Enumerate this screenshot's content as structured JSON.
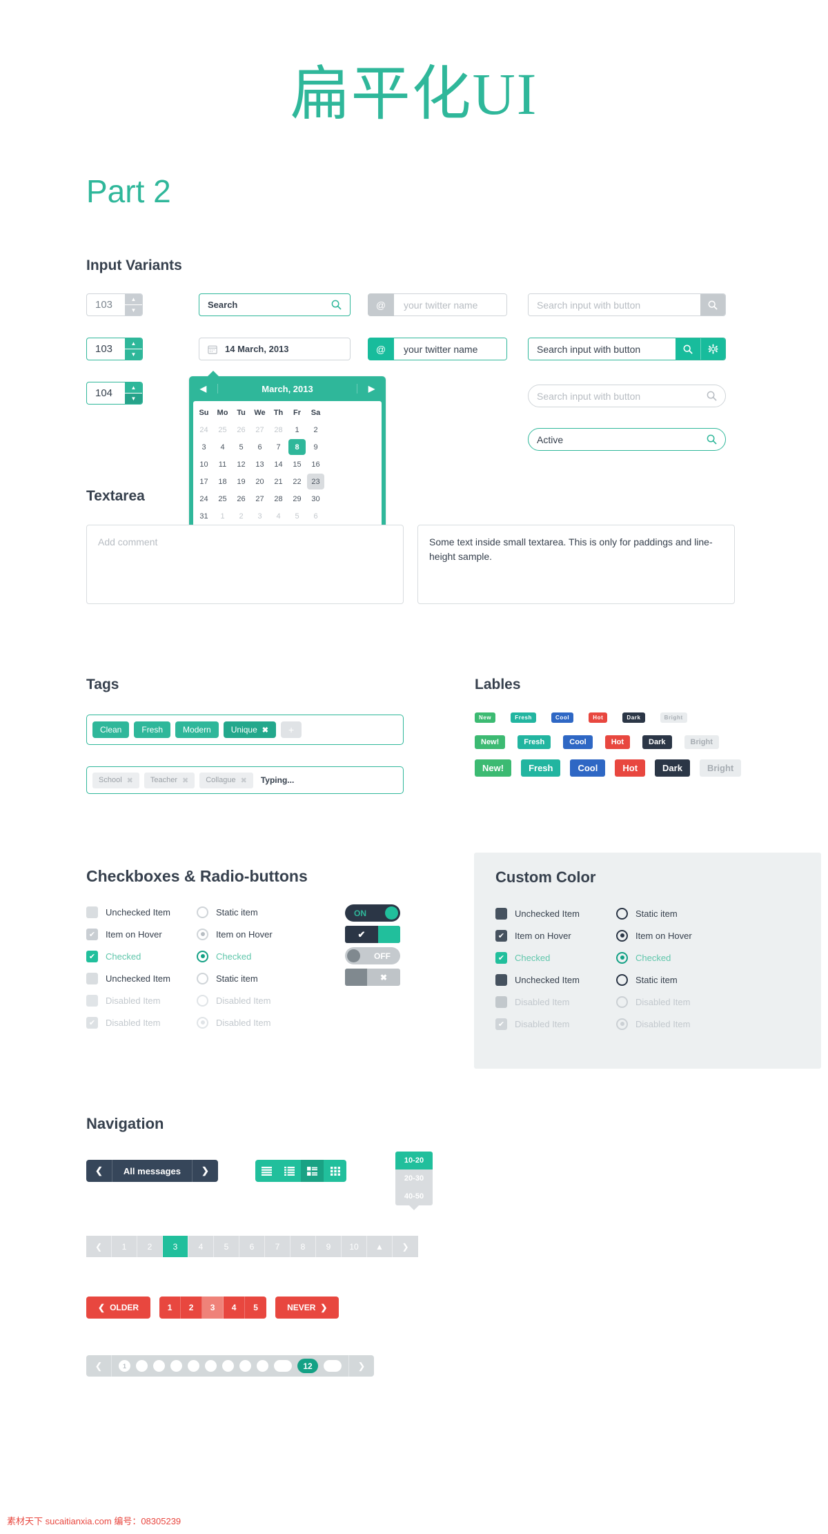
{
  "header": {
    "title": "扁平化UI",
    "subtitle": "Part 2"
  },
  "sections": {
    "input_variants": "Input Variants",
    "textarea": "Textarea",
    "tags": "Tags",
    "labels": "Lables",
    "checkboxes": "Checkboxes & Radio-buttons",
    "custom_color": "Custom Color",
    "navigation": "Navigation"
  },
  "inputs": {
    "spinners": [
      {
        "value": "103",
        "style": "plain"
      },
      {
        "value": "103",
        "style": "teal"
      },
      {
        "value": "104",
        "style": "teal-dark"
      }
    ],
    "search_label": "Search",
    "date_value": "14 March, 2013",
    "twitter_placeholder": "your twitter name",
    "twitter_value": "your twitter name",
    "twitter_prefix": "@",
    "search_button_placeholder": "Search input with button",
    "search_button_value": "Search input with button",
    "rounded_placeholder": "Search input with button",
    "active_value": "Active"
  },
  "datepicker": {
    "title": "March, 2013",
    "prev": "◀",
    "next": "▶",
    "dow": [
      "Su",
      "Mo",
      "Tu",
      "We",
      "Th",
      "Fr",
      "Sa"
    ],
    "weeks": [
      [
        {
          "d": "24",
          "s": "mute"
        },
        {
          "d": "25",
          "s": "mute"
        },
        {
          "d": "26",
          "s": "mute"
        },
        {
          "d": "27",
          "s": "mute"
        },
        {
          "d": "28",
          "s": "mute"
        },
        {
          "d": "1",
          "s": ""
        },
        {
          "d": "2",
          "s": ""
        }
      ],
      [
        {
          "d": "3",
          "s": ""
        },
        {
          "d": "4",
          "s": ""
        },
        {
          "d": "5",
          "s": ""
        },
        {
          "d": "6",
          "s": ""
        },
        {
          "d": "7",
          "s": ""
        },
        {
          "d": "8",
          "s": "sel"
        },
        {
          "d": "9",
          "s": ""
        }
      ],
      [
        {
          "d": "10",
          "s": ""
        },
        {
          "d": "11",
          "s": ""
        },
        {
          "d": "12",
          "s": ""
        },
        {
          "d": "13",
          "s": ""
        },
        {
          "d": "14",
          "s": ""
        },
        {
          "d": "15",
          "s": ""
        },
        {
          "d": "16",
          "s": ""
        }
      ],
      [
        {
          "d": "17",
          "s": ""
        },
        {
          "d": "18",
          "s": ""
        },
        {
          "d": "19",
          "s": ""
        },
        {
          "d": "20",
          "s": ""
        },
        {
          "d": "21",
          "s": ""
        },
        {
          "d": "22",
          "s": ""
        },
        {
          "d": "23",
          "s": "hl"
        }
      ],
      [
        {
          "d": "24",
          "s": ""
        },
        {
          "d": "25",
          "s": ""
        },
        {
          "d": "26",
          "s": ""
        },
        {
          "d": "27",
          "s": ""
        },
        {
          "d": "28",
          "s": ""
        },
        {
          "d": "29",
          "s": ""
        },
        {
          "d": "30",
          "s": ""
        }
      ],
      [
        {
          "d": "31",
          "s": ""
        },
        {
          "d": "1",
          "s": "mute"
        },
        {
          "d": "2",
          "s": "mute"
        },
        {
          "d": "3",
          "s": "mute"
        },
        {
          "d": "4",
          "s": "mute"
        },
        {
          "d": "5",
          "s": "mute"
        },
        {
          "d": "6",
          "s": "mute"
        }
      ]
    ]
  },
  "textarea": {
    "placeholder": "Add comment",
    "small_text": "Some text inside small textarea. This is only for paddings and line-height sample."
  },
  "tags": {
    "row1": [
      {
        "label": "Clean",
        "closable": false
      },
      {
        "label": "Fresh",
        "closable": false
      },
      {
        "label": "Modern",
        "closable": false
      },
      {
        "label": "Unique",
        "closable": true
      }
    ],
    "add_label": "+",
    "row2": [
      {
        "label": "School"
      },
      {
        "label": "Teacher"
      },
      {
        "label": "Collague"
      }
    ],
    "typing": "Typing...",
    "close_glyph": "✖"
  },
  "labels": {
    "small": [
      {
        "text": "New",
        "color": "#3cba72"
      },
      {
        "text": "Fresh",
        "color": "#22b5a0"
      },
      {
        "text": "Cool",
        "color": "#2e67c4"
      },
      {
        "text": "Hot",
        "color": "#e8473f"
      },
      {
        "text": "Dark",
        "color": "#2b3646"
      },
      {
        "text": "Bright",
        "color": "#e9ecee",
        "fg": "#a7adb3"
      }
    ],
    "medium": [
      {
        "text": "New!",
        "color": "#3cba72"
      },
      {
        "text": "Fresh",
        "color": "#22b5a0"
      },
      {
        "text": "Cool",
        "color": "#2e67c4"
      },
      {
        "text": "Hot",
        "color": "#e8473f"
      },
      {
        "text": "Dark",
        "color": "#2b3646"
      },
      {
        "text": "Bright",
        "color": "#e9ecee",
        "fg": "#a7adb3"
      }
    ],
    "large": [
      {
        "text": "New!",
        "color": "#3cba72"
      },
      {
        "text": "Fresh",
        "color": "#22b5a0"
      },
      {
        "text": "Cool",
        "color": "#2e67c4"
      },
      {
        "text": "Hot",
        "color": "#e8473f"
      },
      {
        "text": "Dark",
        "color": "#2b3646"
      },
      {
        "text": "Bright",
        "color": "#e9ecee",
        "fg": "#a7adb3"
      }
    ]
  },
  "checkboxes": {
    "left": [
      {
        "label": "Unchecked Item",
        "state": "unchecked"
      },
      {
        "label": "Item on Hover",
        "state": "hover"
      },
      {
        "label": "Checked",
        "state": "checked"
      },
      {
        "label": "Unchecked Item",
        "state": "unchecked"
      },
      {
        "label": "Disabled Item",
        "state": "disabled"
      },
      {
        "label": "Disabled Item",
        "state": "disabled-checked"
      }
    ],
    "right": [
      {
        "label": "Static item",
        "state": "static"
      },
      {
        "label": "Item on Hover",
        "state": "hover"
      },
      {
        "label": "Checked",
        "state": "checked"
      },
      {
        "label": "Static item",
        "state": "static"
      },
      {
        "label": "Disabled Item",
        "state": "disabled"
      },
      {
        "label": "Disabled Item",
        "state": "disabled-checked"
      }
    ]
  },
  "custom": {
    "left": [
      {
        "label": "Unchecked Item",
        "state": "unchecked"
      },
      {
        "label": "Item on Hover",
        "state": "hover"
      },
      {
        "label": "Checked",
        "state": "checked"
      },
      {
        "label": "Unchecked Item",
        "state": "unchecked"
      },
      {
        "label": "Disabled Item",
        "state": "disabled"
      },
      {
        "label": "Disabled Item",
        "state": "disabled-checked"
      }
    ],
    "right": [
      {
        "label": "Static item",
        "state": "static"
      },
      {
        "label": "Item on Hover",
        "state": "hover"
      },
      {
        "label": "Checked",
        "state": "checked"
      },
      {
        "label": "Static item",
        "state": "static"
      },
      {
        "label": "Disabled Item",
        "state": "disabled"
      },
      {
        "label": "Disabled Item",
        "state": "disabled-checked"
      }
    ]
  },
  "toggles": {
    "on_label": "ON",
    "off_label": "OFF",
    "check_glyph": "✔",
    "cross_glyph": "✖"
  },
  "navigation": {
    "all_messages": "All messages",
    "prev_glyph": "❮",
    "next_glyph": "❯",
    "view_modes": [
      "list-view-icon",
      "detail-list-icon",
      "list-grid-icon",
      "grid-view-icon"
    ],
    "dropdown": {
      "selected": "10-20",
      "options": [
        "20-30",
        "40-50"
      ]
    },
    "pagination": {
      "prev": "❮",
      "next": "❯",
      "up": "▲",
      "pages": [
        "1",
        "2",
        "3",
        "4",
        "5",
        "6",
        "7",
        "8",
        "9",
        "10"
      ],
      "active": "3"
    },
    "red_pagination": {
      "older": "OLDER",
      "never": "NEVER",
      "pages": [
        "1",
        "2",
        "3",
        "4",
        "5"
      ],
      "active": "3"
    },
    "dot_pagination": {
      "first": "1",
      "current": "12",
      "dots": 9
    }
  },
  "footer": {
    "text": "素材天下 sucaitianxia.com 编号：08305239"
  },
  "colors": {
    "accent": "#2fb79a",
    "accent_bright": "#21bf9c",
    "dark": "#36465a",
    "red": "#e8473f",
    "grey": "#d9dcdf"
  }
}
